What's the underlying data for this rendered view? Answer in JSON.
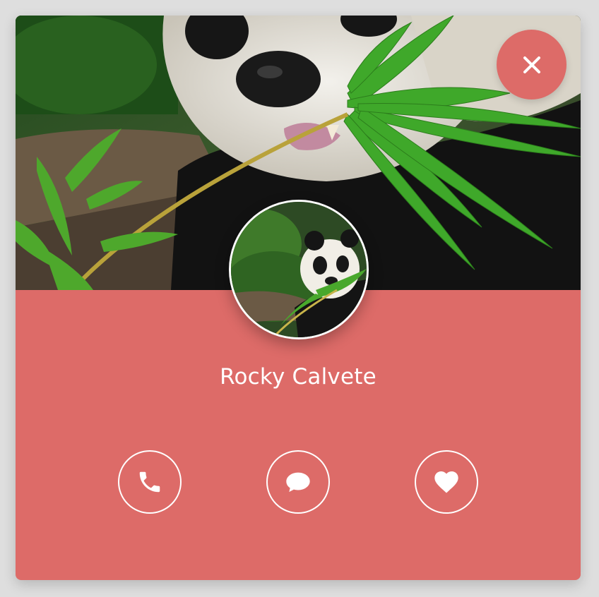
{
  "profile": {
    "name": "Rocky Calvete"
  },
  "colors": {
    "accent": "#dd6b68",
    "background": "#dedede",
    "icon": "#ffffff"
  },
  "cover": {
    "image": "panda-eating-bamboo-photo"
  },
  "avatar": {
    "image": "panda-eating-bamboo-photo"
  },
  "close_button": {
    "icon": "close-icon"
  },
  "actions": [
    {
      "icon": "phone-icon"
    },
    {
      "icon": "chat-bubble-icon"
    },
    {
      "icon": "heart-icon"
    }
  ]
}
